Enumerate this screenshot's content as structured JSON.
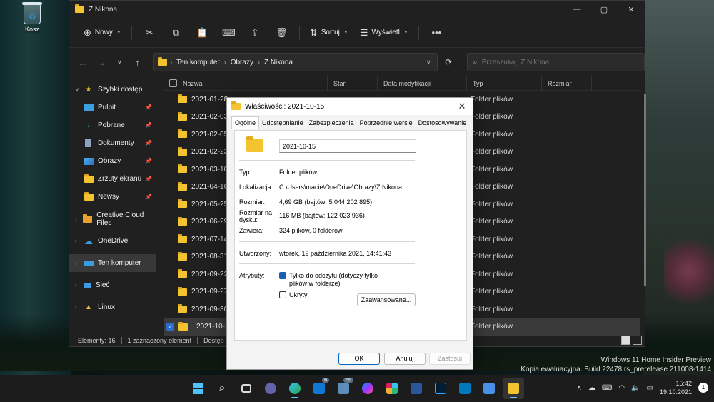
{
  "desktop": {
    "recycle_bin_label": "Kosz"
  },
  "explorer": {
    "title": "Z Nikona",
    "cmdbar": {
      "new_label": "Nowy",
      "sort_label": "Sortuj",
      "view_label": "Wyświetl"
    },
    "address": {
      "crumbs": [
        "Ten komputer",
        "Obrazy",
        "Z Nikona"
      ]
    },
    "search_placeholder": "Przeszukaj: Z Nikona",
    "sidebar": {
      "quick_access": "Szybki dostęp",
      "pinned": [
        "Pulpit",
        "Pobrane",
        "Dokumenty",
        "Obrazy",
        "Zrzuty ekranu",
        "Newsy"
      ],
      "creative_cloud": "Creative Cloud Files",
      "onedrive": "OneDrive",
      "this_pc": "Ten komputer",
      "network": "Sieć",
      "linux": "Linux"
    },
    "columns": [
      "Nazwa",
      "Stan",
      "Data modyfikacji",
      "Typ",
      "Rozmiar"
    ],
    "files": [
      {
        "name": "2021-01-28",
        "type": "Folder plików"
      },
      {
        "name": "2021-02-03",
        "type": "Folder plików"
      },
      {
        "name": "2021-02-05",
        "type": "Folder plików"
      },
      {
        "name": "2021-02-23",
        "type": "Folder plików"
      },
      {
        "name": "2021-03-10",
        "type": "Folder plików"
      },
      {
        "name": "2021-04-16",
        "type": "Folder plików"
      },
      {
        "name": "2021-05-25",
        "type": "Folder plików"
      },
      {
        "name": "2021-06-29",
        "type": "Folder plików"
      },
      {
        "name": "2021-07-14",
        "type": "Folder plików"
      },
      {
        "name": "2021-08-31",
        "type": "Folder plików"
      },
      {
        "name": "2021-09-22",
        "type": "Folder plików"
      },
      {
        "name": "2021-09-27",
        "type": "Folder plików"
      },
      {
        "name": "2021-09-30",
        "type": "Folder plików"
      },
      {
        "name": "2021-10-15",
        "type": "Folder plików"
      }
    ],
    "status": {
      "items": "Elementy: 16",
      "selected": "1 zaznaczony element",
      "availability": "Dostęp"
    }
  },
  "dialog": {
    "title": "Właściwości: 2021-10-15",
    "tabs": [
      "Ogólne",
      "Udostępnianie",
      "Zabezpieczenia",
      "Poprzednie wersje",
      "Dostosowywanie"
    ],
    "name_value": "2021-10-15",
    "props": {
      "type_label": "Typ:",
      "type_value": "Folder plików",
      "location_label": "Lokalizacja:",
      "location_value": "C:\\Users\\macie\\OneDrive\\Obrazy\\Z Nikona",
      "size_label": "Rozmiar:",
      "size_value": "4,69 GB (bajtów: 5 044 202 895)",
      "disk_label_1": "Rozmiar na",
      "disk_label_2": "dysku:",
      "disk_value": "116 MB (bajtów: 122 023 936)",
      "contains_label": "Zawiera:",
      "contains_value": "324 plików, 0 folderów",
      "created_label": "Utworzony:",
      "created_value": "wtorek, 19 października 2021, 14:41:43",
      "attributes_label": "Atrybuty:",
      "readonly_1": "Tylko do odczytu (dotyczy tylko",
      "readonly_2": "plików w folderze)",
      "hidden": "Ukryty",
      "advanced": "Zaawansowane..."
    },
    "buttons": {
      "ok": "OK",
      "cancel": "Anuluj",
      "apply": "Zastosuj"
    }
  },
  "watermark": {
    "line1": "Windows 11 Home Insider Preview",
    "line2": "Kopia ewaluacyjna. Build 22478.rs_prerelease.211008-1414"
  },
  "taskbar": {
    "badges": {
      "mail": "6",
      "teams": "56"
    },
    "time": "15:42",
    "date": "19.10.2021",
    "notifications": "1"
  }
}
